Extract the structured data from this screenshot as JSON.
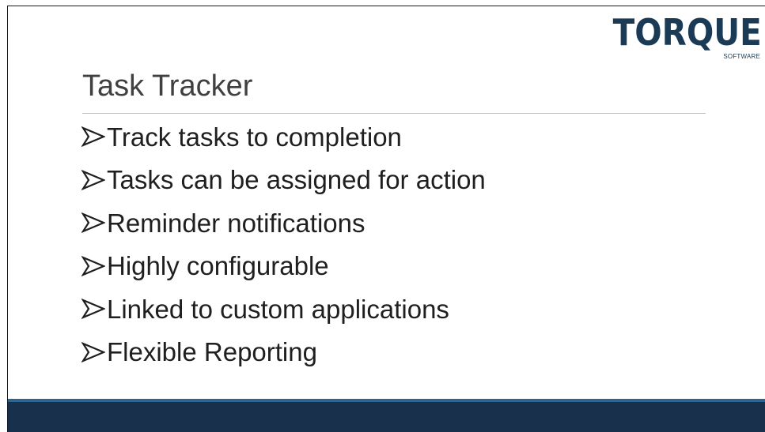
{
  "slide": {
    "title": "Task Tracker",
    "bullets": [
      "Track tasks to completion",
      "Tasks can be assigned for action",
      "Reminder notifications",
      "Highly configurable",
      "Linked to custom applications",
      "Flexible Reporting"
    ],
    "bullet_icon": "arrow-bullet-icon"
  },
  "logo": {
    "word": "TORQUE",
    "sub": "SOFTWARE"
  },
  "colors": {
    "brand": "#1a3a56",
    "footer_bar": "#18304b",
    "footer_stripe": "#2e6590",
    "title_text": "#404040",
    "rule": "#bfbfbf"
  }
}
